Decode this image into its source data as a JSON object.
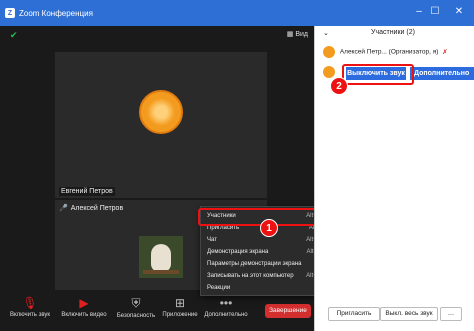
{
  "window": {
    "title": "Zoom Конференция"
  },
  "meeting": {
    "view_label": "Вид",
    "tile1_name": "Евгений Петров",
    "tile2_name": "Алексей Петров"
  },
  "toolbar": {
    "mute": "Включить звук",
    "video": "Включить видео",
    "security": "Безопасность",
    "apps": "Приложение",
    "more": "Дополнительно",
    "end": "Завершение"
  },
  "context_menu": {
    "items": [
      {
        "label": "Участники",
        "shortcut": "Alt+U"
      },
      {
        "label": "Пригласить",
        "shortcut": "Alt+I"
      },
      {
        "label": "Чат",
        "shortcut": "Alt+H"
      },
      {
        "label": "Демонстрация экрана",
        "shortcut": "Alt+S"
      },
      {
        "label": "Параметры демонстрации экрана",
        "shortcut": ""
      },
      {
        "label": "Записывать на этот компьютер",
        "shortcut": "Alt+R"
      },
      {
        "label": "Реакции",
        "shortcut": ""
      }
    ]
  },
  "participants_panel": {
    "title": "Участники (2)",
    "row1_name": "Алексей Петр... (Организатор, я)",
    "mute_btn": "Выключить звук",
    "more_btn": "Дополнительно",
    "invite_btn": "Пригласить",
    "mute_all_btn": "Выкл. весь звук"
  },
  "annotations": {
    "badge1": "1",
    "badge2": "2"
  },
  "colors": {
    "titlebar": "#2e6fd6",
    "end": "#d32f2f",
    "highlight": "#e11111",
    "button_blue": "#2d6cdf"
  }
}
